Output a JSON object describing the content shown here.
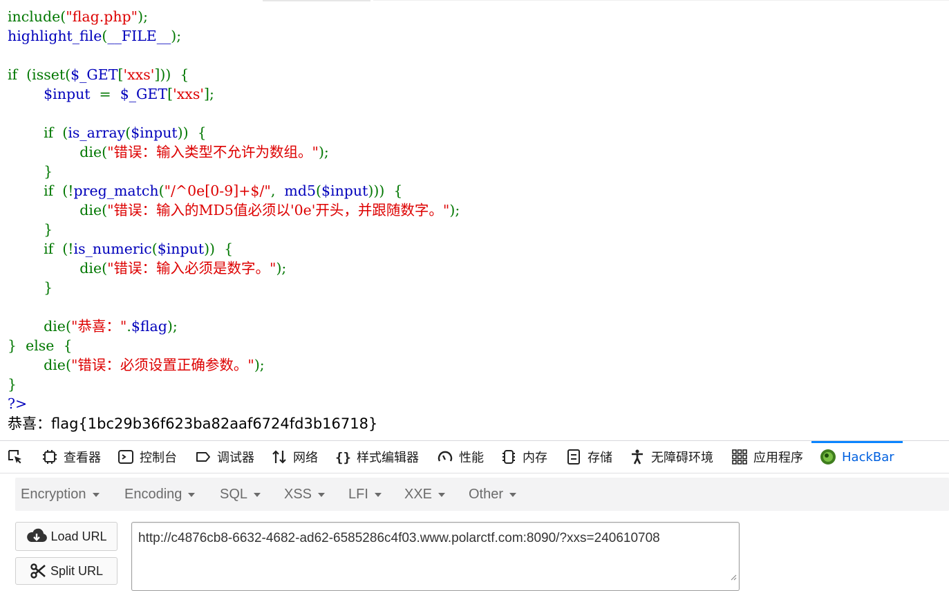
{
  "code_lines": [
    {
      "tokens": [
        {
          "t": "include(",
          "c": "kw"
        },
        {
          "t": "\"flag.php\"",
          "c": "st"
        },
        {
          "t": ");",
          "c": "kw"
        }
      ]
    },
    {
      "tokens": [
        {
          "t": "highlight_file",
          "c": "tx"
        },
        {
          "t": "(",
          "c": "kw"
        },
        {
          "t": "__FILE__",
          "c": "tx"
        },
        {
          "t": ");",
          "c": "kw"
        }
      ]
    },
    {
      "tokens": []
    },
    {
      "tokens": [
        {
          "t": "if  (isset(",
          "c": "kw"
        },
        {
          "t": "$_GET",
          "c": "tx"
        },
        {
          "t": "[",
          "c": "kw"
        },
        {
          "t": "'xxs'",
          "c": "st"
        },
        {
          "t": "]))  {",
          "c": "kw"
        }
      ]
    },
    {
      "tokens": [
        {
          "t": "        ",
          "c": "kw"
        },
        {
          "t": "$input  ",
          "c": "tx"
        },
        {
          "t": "=  ",
          "c": "kw"
        },
        {
          "t": "$_GET",
          "c": "tx"
        },
        {
          "t": "[",
          "c": "kw"
        },
        {
          "t": "'xxs'",
          "c": "st"
        },
        {
          "t": "];",
          "c": "kw"
        }
      ]
    },
    {
      "tokens": []
    },
    {
      "tokens": [
        {
          "t": "        if  (",
          "c": "kw"
        },
        {
          "t": "is_array",
          "c": "tx"
        },
        {
          "t": "(",
          "c": "kw"
        },
        {
          "t": "$input",
          "c": "tx"
        },
        {
          "t": "))  {",
          "c": "kw"
        }
      ]
    },
    {
      "tokens": [
        {
          "t": "                die(",
          "c": "kw"
        },
        {
          "t": "\"错误：输入类型不允许为数组。\"",
          "c": "st"
        },
        {
          "t": ");",
          "c": "kw"
        }
      ]
    },
    {
      "tokens": [
        {
          "t": "        }",
          "c": "kw"
        }
      ]
    },
    {
      "tokens": [
        {
          "t": "        if  (!",
          "c": "kw"
        },
        {
          "t": "preg_match",
          "c": "tx"
        },
        {
          "t": "(",
          "c": "kw"
        },
        {
          "t": "\"/^0e[0-9]+$/\"",
          "c": "st"
        },
        {
          "t": ",  ",
          "c": "kw"
        },
        {
          "t": "md5",
          "c": "tx"
        },
        {
          "t": "(",
          "c": "kw"
        },
        {
          "t": "$input",
          "c": "tx"
        },
        {
          "t": ")))  {",
          "c": "kw"
        }
      ]
    },
    {
      "tokens": [
        {
          "t": "                die(",
          "c": "kw"
        },
        {
          "t": "\"错误：输入的MD5值必须以'0e'开头，并跟随数字。\"",
          "c": "st"
        },
        {
          "t": ");",
          "c": "kw"
        }
      ]
    },
    {
      "tokens": [
        {
          "t": "        }",
          "c": "kw"
        }
      ]
    },
    {
      "tokens": [
        {
          "t": "        if  (!",
          "c": "kw"
        },
        {
          "t": "is_numeric",
          "c": "tx"
        },
        {
          "t": "(",
          "c": "kw"
        },
        {
          "t": "$input",
          "c": "tx"
        },
        {
          "t": "))  {",
          "c": "kw"
        }
      ]
    },
    {
      "tokens": [
        {
          "t": "                die(",
          "c": "kw"
        },
        {
          "t": "\"错误：输入必须是数字。\"",
          "c": "st"
        },
        {
          "t": ");",
          "c": "kw"
        }
      ]
    },
    {
      "tokens": [
        {
          "t": "        }",
          "c": "kw"
        }
      ]
    },
    {
      "tokens": []
    },
    {
      "tokens": [
        {
          "t": "        die(",
          "c": "kw"
        },
        {
          "t": "\"恭喜：\"",
          "c": "st"
        },
        {
          "t": ".",
          "c": "kw"
        },
        {
          "t": "$flag",
          "c": "tx"
        },
        {
          "t": ");",
          "c": "kw"
        }
      ]
    },
    {
      "tokens": [
        {
          "t": "}  else  {",
          "c": "kw"
        }
      ]
    },
    {
      "tokens": [
        {
          "t": "        die(",
          "c": "kw"
        },
        {
          "t": "\"错误：必须设置正确参数。\"",
          "c": "st"
        },
        {
          "t": ");",
          "c": "kw"
        }
      ]
    },
    {
      "tokens": [
        {
          "t": "}",
          "c": "kw"
        }
      ]
    },
    {
      "tokens": [
        {
          "t": "?>",
          "c": "tx"
        }
      ]
    }
  ],
  "output": {
    "flag_text": "恭喜：flag{1bc29b36f623ba82aaf6724fd3b16718}"
  },
  "devtools": {
    "tabs": [
      {
        "label": "查看器",
        "icon": "inspector-icon"
      },
      {
        "label": "控制台",
        "icon": "console-icon"
      },
      {
        "label": "调试器",
        "icon": "debugger-icon"
      },
      {
        "label": "网络",
        "icon": "network-icon"
      },
      {
        "label": "样式编辑器",
        "icon": "style-editor-icon"
      },
      {
        "label": "性能",
        "icon": "performance-icon"
      },
      {
        "label": "内存",
        "icon": "memory-icon"
      },
      {
        "label": "存储",
        "icon": "storage-icon"
      },
      {
        "label": "无障碍环境",
        "icon": "accessibility-icon"
      },
      {
        "label": "应用程序",
        "icon": "application-icon"
      },
      {
        "label": "HackBar",
        "icon": "hackbar-icon",
        "active": true
      }
    ]
  },
  "hackbar": {
    "menus": [
      "Encryption",
      "Encoding",
      "SQL",
      "XSS",
      "LFI",
      "XXE",
      "Other"
    ],
    "load_url_label": "Load URL",
    "split_url_label": "Split URL",
    "url_value": "http://c4876cb8-6632-4682-ad62-6585286c4f03.www.polarctf.com:8090/?xxs=240610708"
  },
  "colors": {
    "keyword": "#007700",
    "identifier": "#0000bb",
    "string": "#dd0000",
    "active_tab": "#0060df"
  }
}
